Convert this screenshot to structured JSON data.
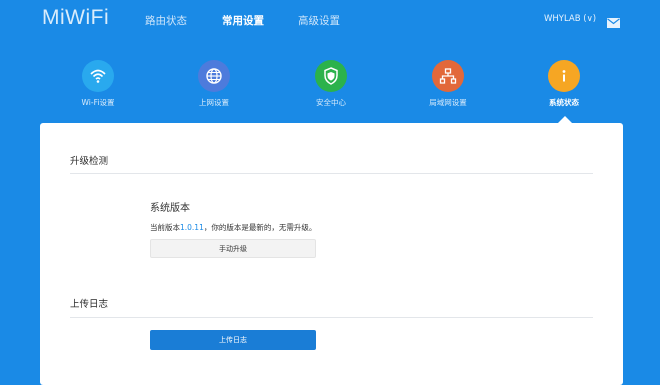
{
  "header": {
    "logo": "MiWiFi",
    "nav": [
      {
        "label": "路由状态",
        "active": false
      },
      {
        "label": "常用设置",
        "active": true
      },
      {
        "label": "高级设置",
        "active": false
      }
    ],
    "user_label": "WHYLAB (∨)",
    "mail_icon": "mail-icon"
  },
  "tiles": [
    {
      "label": "Wi-Fi设置",
      "icon": "wifi-icon",
      "color": "#29a9ee"
    },
    {
      "label": "上网设置",
      "icon": "globe-icon",
      "color": "#4d7bdc"
    },
    {
      "label": "安全中心",
      "icon": "shield-icon",
      "color": "#2bb24c"
    },
    {
      "label": "局域网设置",
      "icon": "network-icon",
      "color": "#e2683a"
    },
    {
      "label": "系统状态",
      "icon": "info-icon",
      "color": "#f6a623",
      "active": true
    }
  ],
  "upgrade": {
    "section_title": "升级检测",
    "system_version_title": "系统版本",
    "version_prefix": "当前版本",
    "version_number": "1.0.11",
    "version_suffix": "，你的版本是最新的，无需升级。",
    "manual_button": "手动升级"
  },
  "log": {
    "section_title": "上传日志",
    "upload_button": "上传日志"
  },
  "colors": {
    "background": "#1a8ae6",
    "accent": "#1a7dd6",
    "panel": "#ffffff"
  }
}
